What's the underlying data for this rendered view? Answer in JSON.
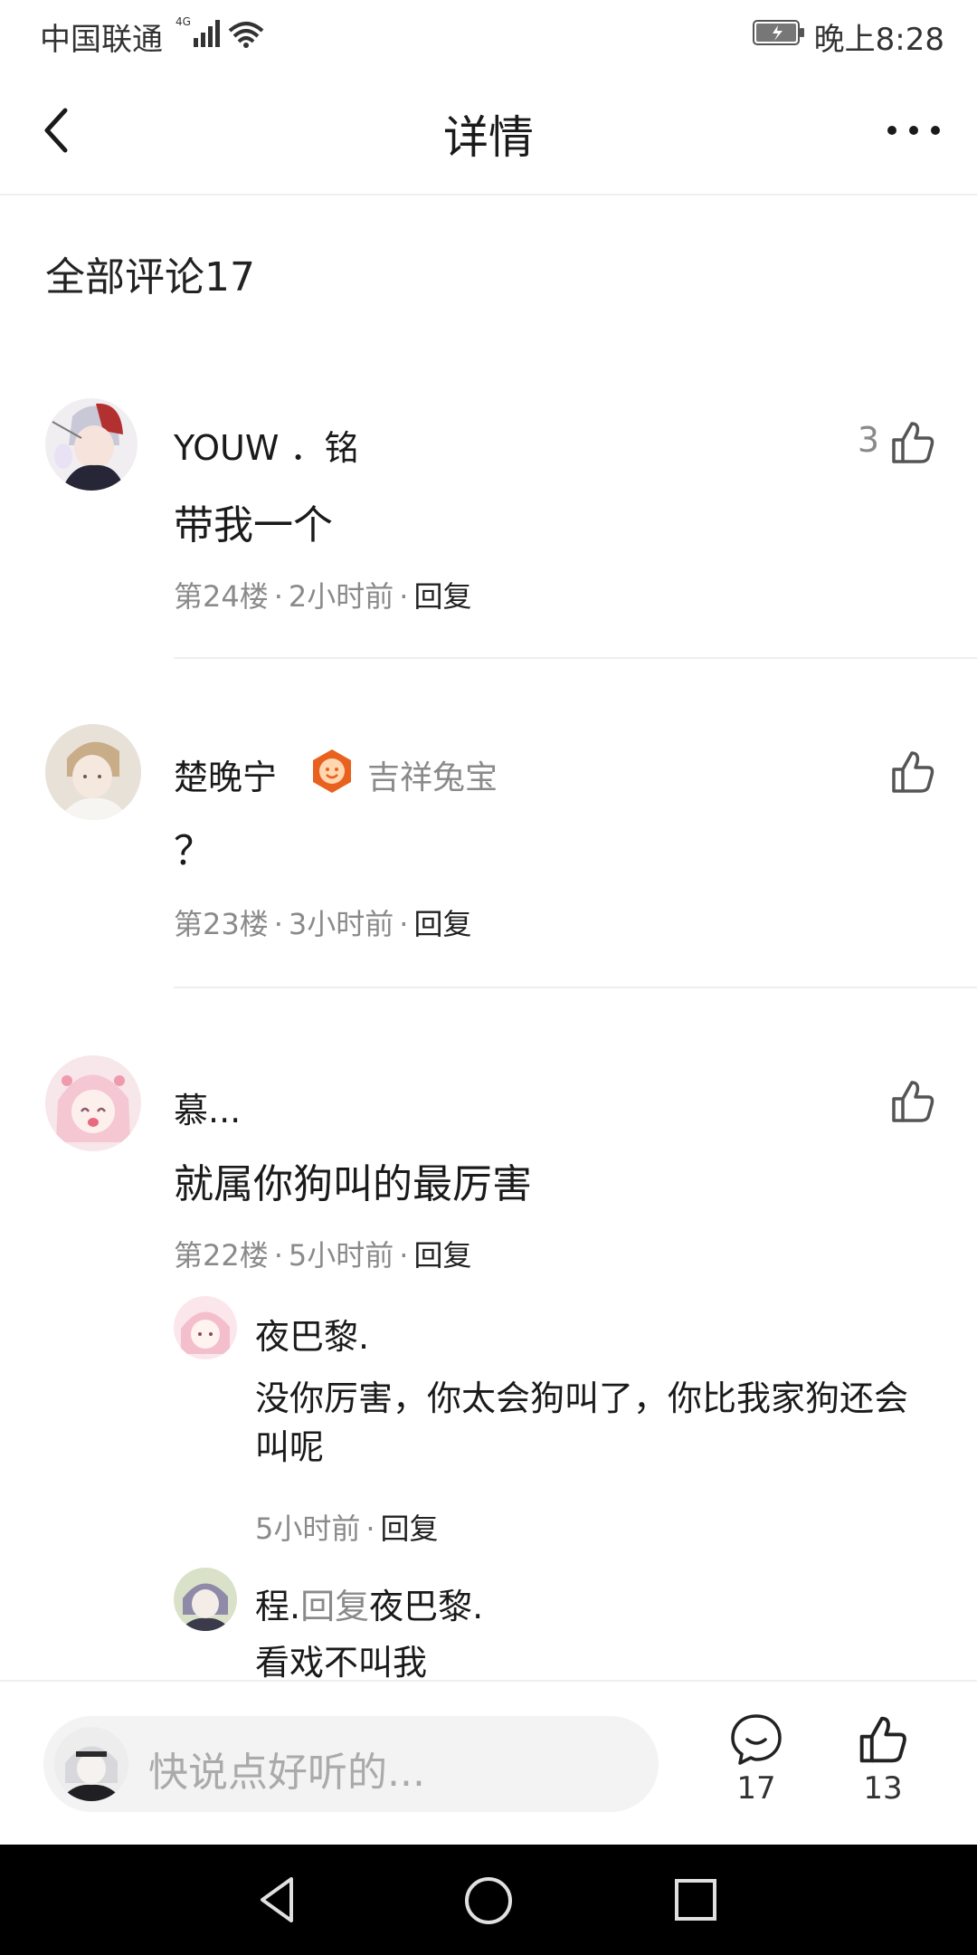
{
  "status_bar": {
    "carrier": "中国联通",
    "network": "4G",
    "time": "晚上8:28"
  },
  "header": {
    "title": "详情"
  },
  "comments_section": {
    "title": "全部评论17"
  },
  "comments": [
    {
      "name": "YOUW ．铭",
      "text": "带我一个",
      "floor": "第24楼",
      "time": "2小时前",
      "reply_label": "回复",
      "likes": "3"
    },
    {
      "name": "楚晚宁",
      "badge": "吉祥兔宝",
      "text": "？",
      "floor": "第23楼",
      "time": "3小时前",
      "reply_label": "回复"
    },
    {
      "name": "慕...",
      "text": "就属你狗叫的最厉害",
      "floor": "第22楼",
      "time": "5小时前",
      "reply_label": "回复",
      "replies": [
        {
          "name": "夜巴黎.",
          "text": "没你厉害，你太会狗叫了，你比我家狗还会叫呢",
          "time": "5小时前",
          "reply_label": "回复"
        },
        {
          "name": "程.",
          "reply_word": "回复",
          "target": "夜巴黎.",
          "text": "看戏不叫我"
        }
      ]
    }
  ],
  "bottom_bar": {
    "placeholder": "快说点好听的...",
    "comment_count": "17",
    "like_count": "13"
  },
  "colors": {
    "badge": "#e8611e",
    "text": "#1a1a1a",
    "meta": "#8a8a8a"
  }
}
